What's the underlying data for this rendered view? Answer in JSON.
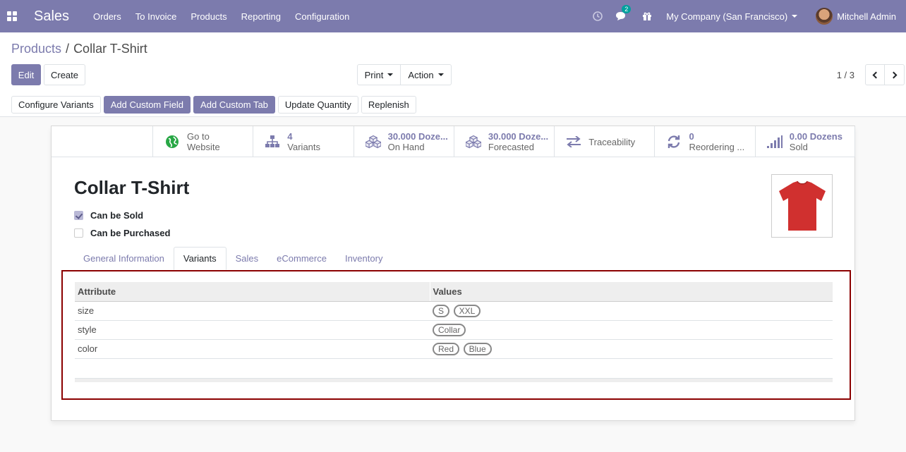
{
  "navbar": {
    "app_name": "Sales",
    "menu": [
      "Orders",
      "To Invoice",
      "Products",
      "Reporting",
      "Configuration"
    ],
    "messages_count": "2",
    "company": "My Company (San Francisco)",
    "user": "Mitchell Admin"
  },
  "breadcrumb": {
    "parent": "Products",
    "separator": "/",
    "current": "Collar T-Shirt"
  },
  "buttons": {
    "edit": "Edit",
    "create": "Create",
    "print": "Print",
    "action": "Action",
    "configure_variants": "Configure Variants",
    "add_custom_field": "Add Custom Field",
    "add_custom_tab": "Add Custom Tab",
    "update_quantity": "Update Quantity",
    "replenish": "Replenish"
  },
  "pager": {
    "value": "1 / 3"
  },
  "stat_buttons": [
    {
      "value": "Go to",
      "label": "Website",
      "icon": "globe-icon"
    },
    {
      "value": "4",
      "label": "Variants",
      "icon": "sitemap-icon"
    },
    {
      "value": "30.000 Doze...",
      "label": "On Hand",
      "icon": "cubes-icon"
    },
    {
      "value": "30.000 Doze...",
      "label": "Forecasted",
      "icon": "cubes-icon"
    },
    {
      "value": "",
      "label": "Traceability",
      "icon": "exchange-icon"
    },
    {
      "value": "0",
      "label": "Reordering ...",
      "icon": "refresh-icon"
    },
    {
      "value": "0.00 Dozens",
      "label": "Sold",
      "icon": "signal-icon"
    }
  ],
  "product": {
    "name": "Collar T-Shirt",
    "can_be_sold_label": "Can be Sold",
    "can_be_sold": true,
    "can_be_purchased_label": "Can be Purchased",
    "can_be_purchased": false,
    "image_color": "#d0302f"
  },
  "tabs": [
    "General Information",
    "Variants",
    "Sales",
    "eCommerce",
    "Inventory"
  ],
  "active_tab": "Variants",
  "variants_table": {
    "headers": [
      "Attribute",
      "Values"
    ],
    "rows": [
      {
        "attribute": "size",
        "values": [
          "S",
          "XXL"
        ]
      },
      {
        "attribute": "style",
        "values": [
          "Collar"
        ]
      },
      {
        "attribute": "color",
        "values": [
          "Red",
          "Blue"
        ]
      }
    ]
  },
  "colors": {
    "brand": "#7c7bad",
    "highlight_border": "#8b0000"
  }
}
